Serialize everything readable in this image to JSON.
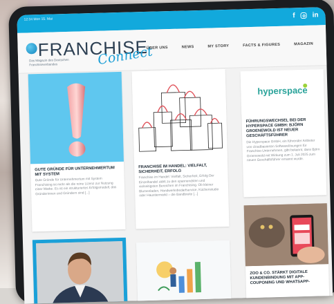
{
  "status": {
    "left": "12:34  Mon 15. Mai"
  },
  "social": {
    "facebook": "f",
    "linkedin": "in"
  },
  "logo": {
    "main": "FRANCHISE",
    "script": "Connect",
    "subtitle": "Das Magazin des Deutschen Franchiseverbandes"
  },
  "nav": [
    "ÜBER UNS",
    "NEWS",
    "MY STORY",
    "FACTS & FIGURES",
    "MAGAZIN"
  ],
  "cards": {
    "c1": {
      "title": "GUTE GRÜNDE FÜR UNTERNEHMERTUM MIT SYSTEM",
      "text": "Gute Gründe für Unternehmertum mit System Franchising ist mehr als die reine Lizenz zur Nutzung einer Marke. Es ist ein strukturiertes Erfolgsmodell, das Gründerinnen und Gründern sind [...]"
    },
    "c2": {
      "title": "FRANCHISE IM HANDEL: VIELFALT, SICHERHEIT, ERFOLG",
      "text": "Franchise im Handel: Vielfalt, Sicherheit, Erfolg Der Einzelhandel zählt zu den spannendsten und vielseitigsten Bereichen im Franchising. Ob kleiner Blumenladen, Handwerksbedarfservice, Küchenstudio oder Haustiermarkt – die Bandbreite [...]"
    },
    "c3": {
      "brand": "hyperspace",
      "title": "FÜHRUNGSWECHSEL BEI DER HYPERSPACE GMBH: BJÖRN GROENEWOLD IST NEUER GESCHÄFTSFÜHRER",
      "text": "Die Hyperspace GmbH, ein führender Anbieter von cloudbasierten Softwarelösungen für Franchise-Unternehmen, gibt bekannt, dass Björn Groenewold mit Wirkung zum 1. Juli 2025 zum neuen Geschäftsführer ernannt wurde."
    },
    "c6": {
      "title": "ZOO & CO. STÄRKT DIGITALE KUNDENBINDUNG MIT APP-COUPONING UND WHATSAPP-"
    }
  }
}
